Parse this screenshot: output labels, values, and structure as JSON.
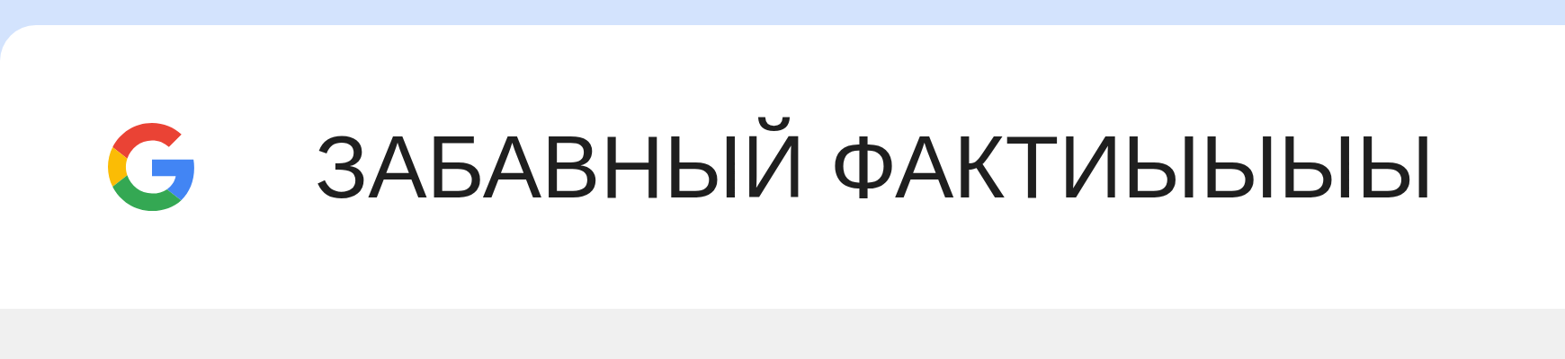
{
  "tab": {
    "title": "ЗАБАВНЫЙ ФАКТИЫЫЫЫ"
  }
}
